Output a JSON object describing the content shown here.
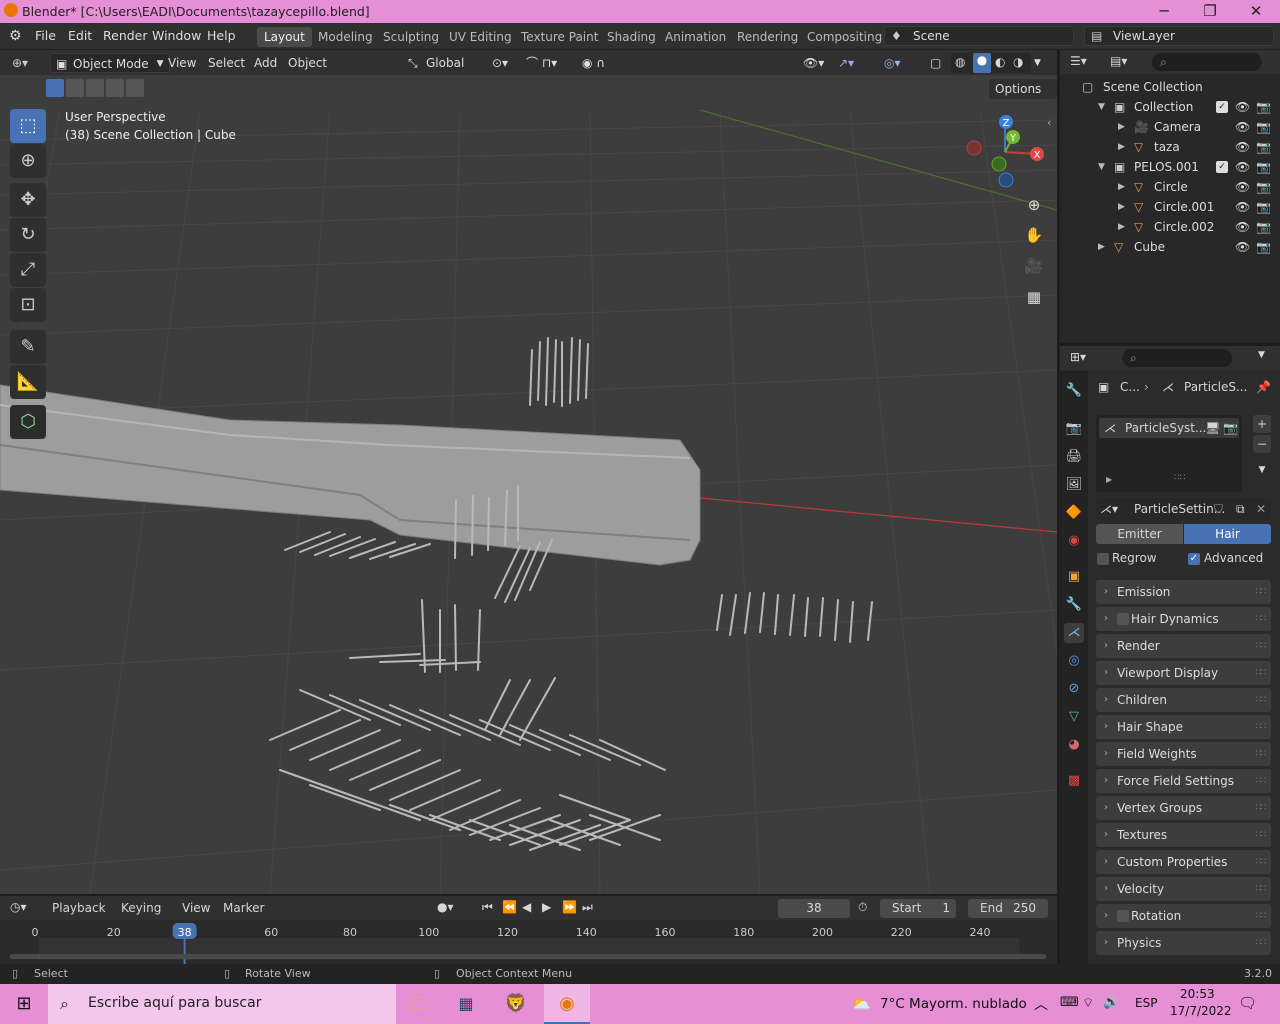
{
  "window": {
    "title": "Blender* [C:\\Users\\EADI\\Documents\\tazaycepillo.blend]",
    "min": "─",
    "max": "❐",
    "close": "✕"
  },
  "menu": [
    "File",
    "Edit",
    "Render",
    "Window",
    "Help"
  ],
  "workspaces": [
    "Layout",
    "Modeling",
    "Sculpting",
    "UV Editing",
    "Texture Paint",
    "Shading",
    "Animation",
    "Rendering",
    "Compositing"
  ],
  "scene": {
    "name": "Scene",
    "view_layer": "ViewLayer"
  },
  "viewport": {
    "mode": "Object Mode",
    "menus": [
      "View",
      "Select",
      "Add",
      "Object"
    ],
    "transform_orientation": "Global",
    "options": "Options",
    "perspective": "User Perspective",
    "info": "(38) Scene Collection | Cube",
    "gizmo": {
      "x": "X",
      "y": "Y",
      "z": "Z"
    },
    "colors": {
      "bg": "#3d3d3d",
      "grid": "#474747",
      "xaxis": "#b83a3a",
      "yaxis": "#4f6b2d",
      "mesh": "#9d9d9d",
      "accent": "#4772b3"
    }
  },
  "outliner": {
    "root": "Scene Collection",
    "items": [
      {
        "name": "Collection",
        "indent": 1,
        "kind": "collection"
      },
      {
        "name": "Camera",
        "indent": 2,
        "kind": "camera"
      },
      {
        "name": "taza",
        "indent": 2,
        "kind": "mesh"
      },
      {
        "name": "PELOS.001",
        "indent": 1,
        "kind": "collection"
      },
      {
        "name": "Circle",
        "indent": 2,
        "kind": "mesh"
      },
      {
        "name": "Circle.001",
        "indent": 2,
        "kind": "mesh"
      },
      {
        "name": "Circle.002",
        "indent": 2,
        "kind": "mesh"
      },
      {
        "name": "Cube",
        "indent": 1,
        "kind": "mesh"
      }
    ]
  },
  "properties": {
    "breadcrumb_obj": "C...",
    "breadcrumb_ps": "ParticleS...",
    "system_name": "ParticleSyst...",
    "settings_name": "ParticleSettin...",
    "type_tabs": [
      "Emitter",
      "Hair"
    ],
    "active_type": "Hair",
    "regrow": "Regrow",
    "advanced": "Advanced",
    "panels": [
      {
        "label": "Emission",
        "check": false
      },
      {
        "label": "Hair Dynamics",
        "check": true
      },
      {
        "label": "Render",
        "check": false
      },
      {
        "label": "Viewport Display",
        "check": false
      },
      {
        "label": "Children",
        "check": false
      },
      {
        "label": "Hair Shape",
        "check": false
      },
      {
        "label": "Field Weights",
        "check": false
      },
      {
        "label": "Force Field Settings",
        "check": false
      },
      {
        "label": "Vertex Groups",
        "check": false
      },
      {
        "label": "Textures",
        "check": false
      },
      {
        "label": "Custom Properties",
        "check": false
      },
      {
        "label": "Velocity",
        "check": false
      },
      {
        "label": "Rotation",
        "check": true
      },
      {
        "label": "Physics",
        "check": false
      }
    ]
  },
  "timeline": {
    "menus": [
      "Playback",
      "Keying",
      "View",
      "Marker"
    ],
    "current_frame": "38",
    "start_label": "Start",
    "start": "1",
    "end_label": "End",
    "end": "250",
    "ticks": [
      "0",
      "20",
      "38",
      "60",
      "80",
      "100",
      "120",
      "140",
      "160",
      "180",
      "200",
      "220",
      "240"
    ],
    "current_value": 38
  },
  "status": {
    "select": "Select",
    "rotate": "Rotate View",
    "context": "Object Context Menu",
    "version": "3.2.0"
  },
  "taskbar": {
    "search": "Escribe aquí para buscar",
    "weather": "7°C  Mayorm. nublado",
    "lang": "ESP",
    "time": "20:53",
    "date": "17/7/2022"
  }
}
